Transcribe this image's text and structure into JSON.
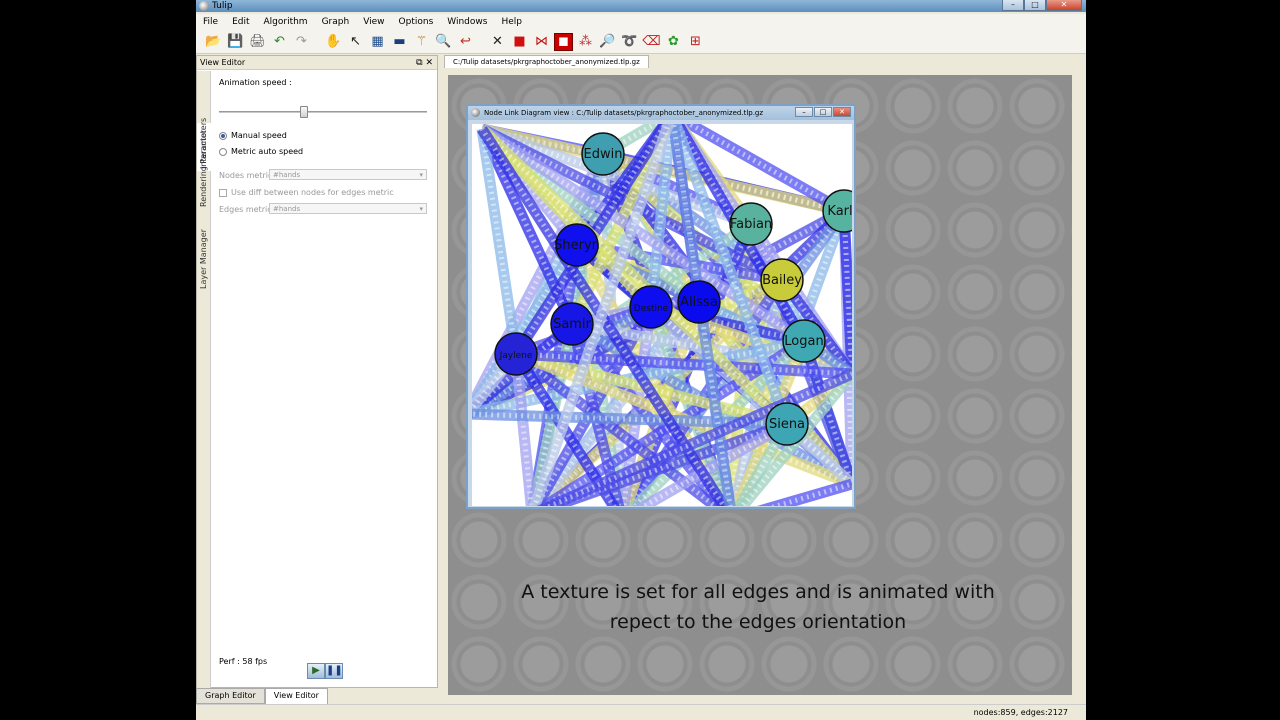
{
  "window": {
    "title": "Tulip",
    "controls": [
      "–",
      "□",
      "✕"
    ]
  },
  "menu": [
    "File",
    "Edit",
    "Algorithm",
    "Graph",
    "View",
    "Options",
    "Windows",
    "Help"
  ],
  "toolbar": [
    {
      "name": "open-icon",
      "glyph": "📂"
    },
    {
      "name": "save-icon",
      "glyph": "💾"
    },
    {
      "name": "print-icon",
      "glyph": "🖨"
    },
    {
      "name": "undo-icon",
      "glyph": "↶"
    },
    {
      "name": "redo-icon",
      "glyph": "↷"
    },
    {
      "name": "hand-navigate-icon",
      "glyph": "✋"
    },
    {
      "name": "select-pointer-icon",
      "glyph": "↖"
    },
    {
      "name": "selection-box-icon",
      "glyph": "▦"
    },
    {
      "name": "rectangle-select-icon",
      "glyph": "▬"
    },
    {
      "name": "magic-wand-icon",
      "glyph": "⚚"
    },
    {
      "name": "zoom-icon",
      "glyph": "🔍"
    },
    {
      "name": "edge-bend-icon",
      "glyph": "↩"
    },
    {
      "name": "delete-icon",
      "glyph": "✕"
    },
    {
      "name": "add-node-icon",
      "glyph": "■"
    },
    {
      "name": "add-edge-icon",
      "glyph": "⋈"
    },
    {
      "name": "node-editor-icon",
      "glyph": "◼",
      "active": true
    },
    {
      "name": "graph-select-icon",
      "glyph": "⁂"
    },
    {
      "name": "magnify-icon",
      "glyph": "🔎"
    },
    {
      "name": "lasso-icon",
      "glyph": "➰"
    },
    {
      "name": "delete-element-icon",
      "glyph": "⌫"
    },
    {
      "name": "neighborhood-icon",
      "glyph": "✿"
    },
    {
      "name": "fisheye-icon",
      "glyph": "⊞"
    }
  ],
  "dock": {
    "title": "View Editor",
    "side_tabs": [
      "Interactor",
      "Rendering Parameters",
      "Layer Manager"
    ],
    "animation_speed_label": "Animation speed :",
    "animation_speed_level": 0.39,
    "manual_speed_label": "Manual speed",
    "metric_auto_label": "Metric auto speed",
    "nodes_metric_label": "Nodes metric :",
    "nodes_metric_value": "#hands",
    "use_diff_label": "Use diff between nodes for edges metric",
    "edges_metric_label": "Edges metric :",
    "edges_metric_value": "#hands",
    "perf_label": "Perf : 58 fps",
    "bottom_tabs": [
      "Graph Editor",
      "View Editor"
    ]
  },
  "doc_tab": "C:/Tulip datasets/pkrgraphoctober_anonymized.tlp.gz",
  "view_window": {
    "title": "Node Link Diagram view : C:/Tulip datasets/pkrgraphoctober_anonymized.tlp.gz",
    "controls": [
      "–",
      "□",
      "✕"
    ]
  },
  "nodes": [
    {
      "label": "Edwin",
      "color": "#3f9fb0"
    },
    {
      "label": "Karlo",
      "color": "#56b3a0"
    },
    {
      "label": "Fabian",
      "color": "#58b29d"
    },
    {
      "label": "Sheryn",
      "color": "#1010ee"
    },
    {
      "label": "Bailey",
      "color": "#c9cc3a"
    },
    {
      "label": "Alissa",
      "color": "#0a0aef"
    },
    {
      "label": "Destine",
      "color": "#0d0df0"
    },
    {
      "label": "Samir",
      "color": "#1616e6"
    },
    {
      "label": "Logan",
      "color": "#3ea9b2"
    },
    {
      "label": "Jaylene",
      "color": "#2424d6"
    },
    {
      "label": "Siena",
      "color": "#3da5b4"
    }
  ],
  "caption": "A texture is set for all edges and is animated with\nrepect to the edges orientation",
  "status": "nodes:859, edges:2127"
}
